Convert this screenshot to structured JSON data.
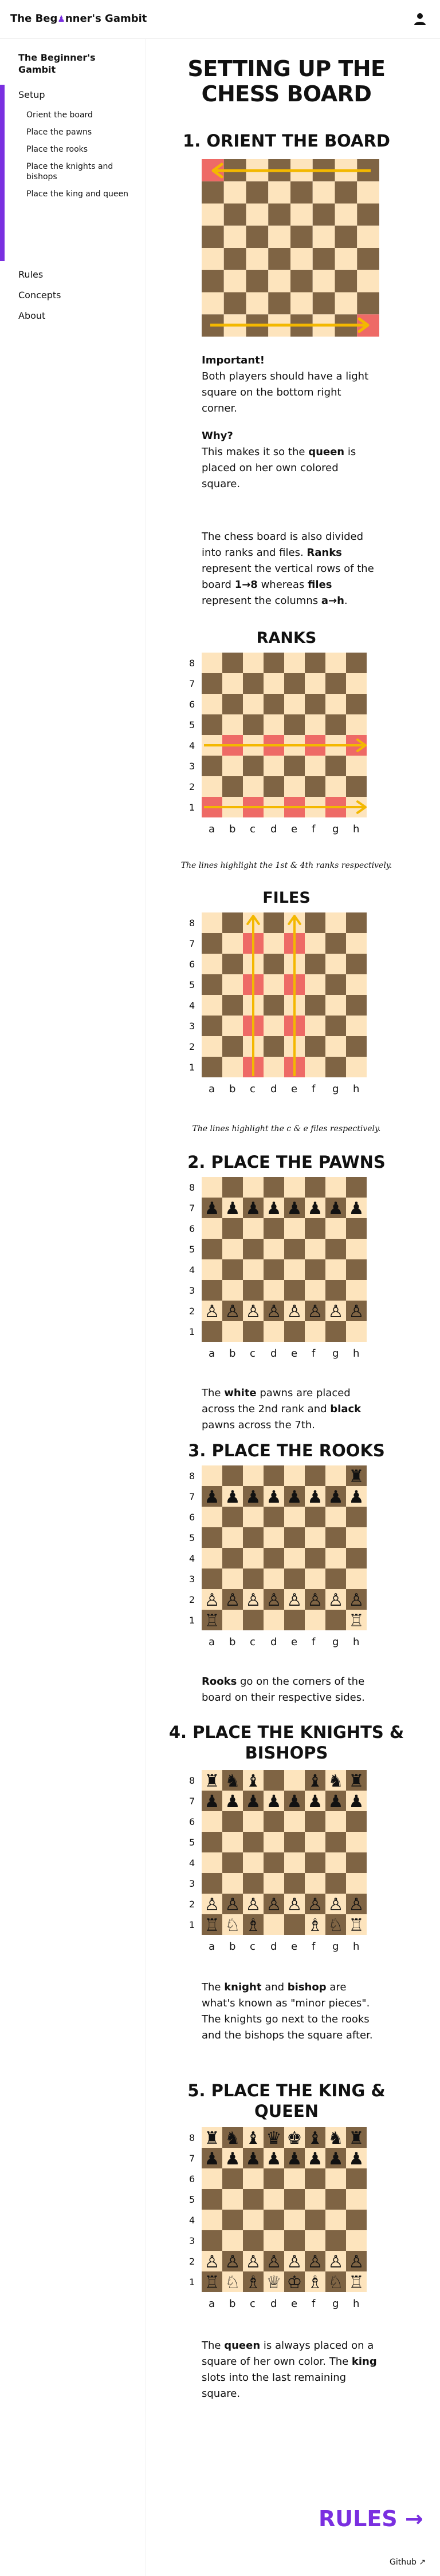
{
  "header": {
    "brand_pre": "The Beg",
    "brand_pawn": "♟",
    "brand_post": "nner's Gambit"
  },
  "sidebar": {
    "title": "The Beginner's Gambit",
    "setup": "Setup",
    "sub_items": [
      "Orient the board",
      "Place the pawns",
      "Place the rooks",
      "Place the knights and bishops",
      "Place the king and queen"
    ],
    "items": [
      "Rules",
      "Concepts",
      "About"
    ]
  },
  "main": {
    "title": "SETTING UP THE CHESS BOARD",
    "s1": "1. ORIENT THE BOARD",
    "important_head": "Important!",
    "important_text": "Both players should have a light square on the bottom right corner.",
    "why_head": "Why?",
    "why_pre": "This makes it so the ",
    "why_queen": "queen",
    "why_post": " is placed on her own colored square.",
    "divide_a": "The chess board is also divided into ranks and files. ",
    "divide_ranks": "Ranks",
    "divide_b": " represent the vertical rows of the board ",
    "divide_range": "1→8",
    "divide_c": " whereas ",
    "divide_files": "files",
    "divide_d": " represent the columns ",
    "divide_cols": "a→h",
    "divide_e": ".",
    "ranks_head": "RANKS",
    "ranks_caption": "The lines highlight the 1st & 4th ranks respectively.",
    "files_head": "FILES",
    "files_caption": "The lines highlight the c & e files respectively.",
    "s2": "2. PLACE THE PAWNS",
    "pawns_a": "The ",
    "pawns_white": "white",
    "pawns_b": " pawns are placed across the 2nd rank and ",
    "pawns_black": "black",
    "pawns_c": " pawns across the 7th.",
    "s3": "3. PLACE THE ROOKS",
    "rooks_bold": "Rooks",
    "rooks_text": " go on the corners of the board on their respective sides.",
    "s4": "4. PLACE THE KNIGHTS & BISHOPS",
    "kb_a": "The ",
    "kb_knight": "knight",
    "kb_b": " and ",
    "kb_bishop": "bishop",
    "kb_c": " are what's known as \"minor pieces\". The knights go next to the rooks and the bishops the square after.",
    "s5": "5. PLACE THE KING & QUEEN",
    "kq_a": "The ",
    "kq_queen": "queen",
    "kq_b": " is always placed on a square of her own color. The ",
    "kq_king": "king",
    "kq_c": " slots into the last remaining square."
  },
  "boards": {
    "files": [
      "a",
      "b",
      "c",
      "d",
      "e",
      "f",
      "g",
      "h"
    ],
    "ranks": [
      "8",
      "7",
      "6",
      "5",
      "4",
      "3",
      "2",
      "1"
    ]
  },
  "footer": {
    "rules": "RULES →",
    "github": "Github"
  },
  "colors": {
    "accent": "#7a2fe0",
    "dark_square": "#7f6444",
    "light_square": "#fde4bd",
    "highlight": "#ee6a66",
    "arrow": "#f3b800"
  }
}
